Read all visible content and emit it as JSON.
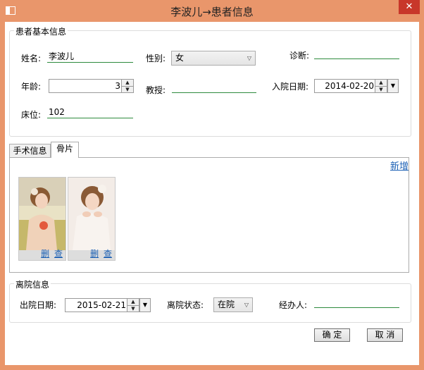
{
  "window": {
    "title": "李波儿→患者信息",
    "close_glyph": "✕"
  },
  "basic": {
    "legend": "患者基本信息",
    "name_label": "姓名:",
    "name_value": "李波儿",
    "gender_label": "性别:",
    "gender_value": "女",
    "diagnosis_label": "诊断:",
    "diagnosis_value": "",
    "age_label": "年龄:",
    "age_value": "3",
    "professor_label": "教授:",
    "professor_value": "",
    "admit_label": "入院日期:",
    "admit_value": "2014-02-20",
    "bed_label": "床位:",
    "bed_value": "102"
  },
  "tabs": [
    {
      "label": "手术信息",
      "active": false
    },
    {
      "label": "骨片",
      "active": true
    }
  ],
  "bone": {
    "add_link": "新增",
    "thumbs": [
      {
        "delete": "删",
        "view": "查"
      },
      {
        "delete": "删",
        "view": "查"
      }
    ]
  },
  "discharge": {
    "legend": "离院信息",
    "date_label": "出院日期:",
    "date_value": "2015-02-21",
    "status_label": "离院状态:",
    "status_value": "在院",
    "handler_label": "经办人:",
    "handler_value": ""
  },
  "actions": {
    "ok": "确 定",
    "cancel": "取 消"
  },
  "colors": {
    "frame": "#e9966b",
    "close": "#c8372a",
    "link": "#1a5fb4",
    "underline": "#2e8b3d"
  }
}
